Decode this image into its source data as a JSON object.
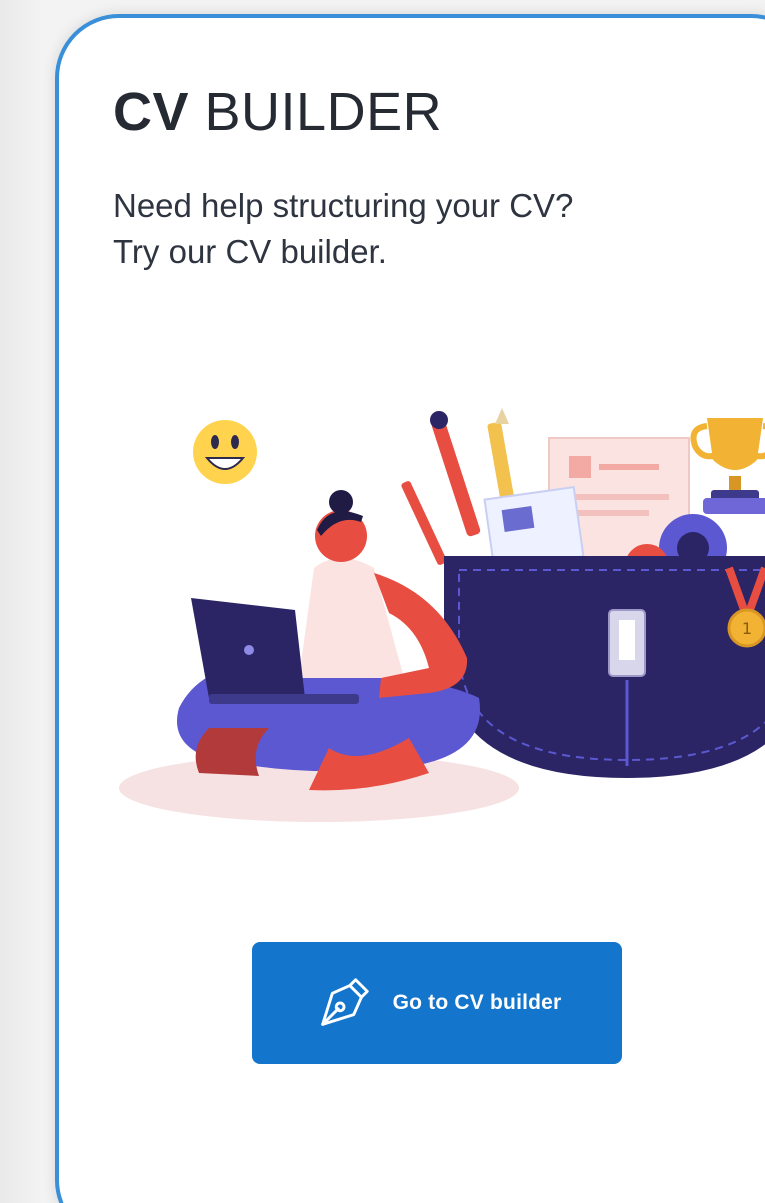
{
  "card": {
    "title_strong": "CV",
    "title_rest": " BUILDER",
    "description_line1": "Need help structuring your CV?",
    "description_line2": "Try our CV builder.",
    "button_label": "Go to CV builder",
    "button_icon": "pen-nib-icon"
  },
  "colors": {
    "card_border": "#3a8fd9",
    "button_bg": "#1376cc",
    "button_text": "#ffffff",
    "title_text": "#252a33"
  }
}
